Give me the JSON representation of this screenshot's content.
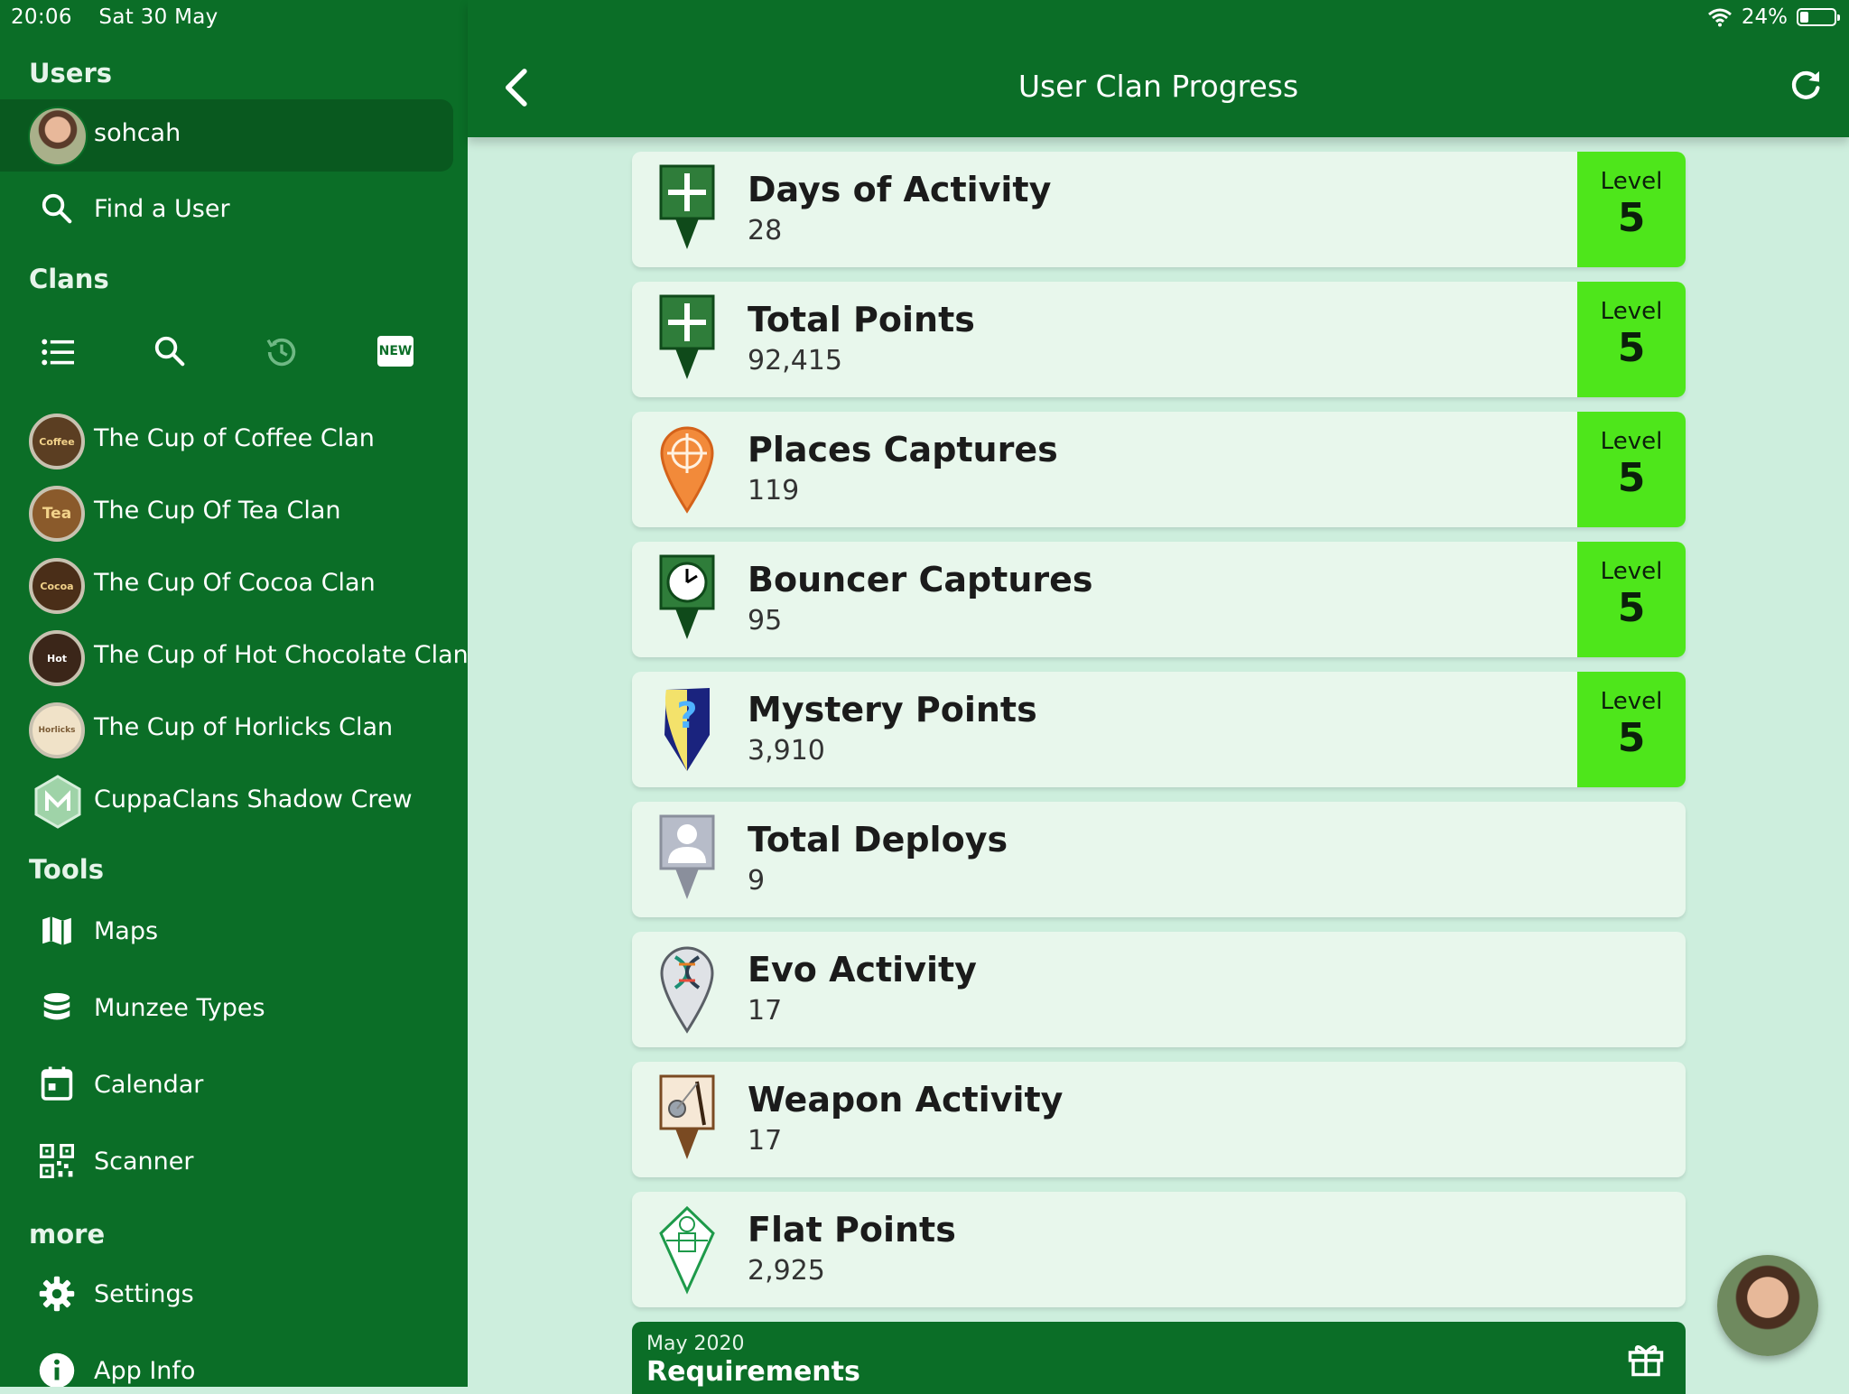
{
  "status_bar": {
    "time": "20:06",
    "date": "Sat 30 May",
    "battery": "24%",
    "battery_level": 0.24
  },
  "sidebar": {
    "users_title": "Users",
    "current_user": "sohcah",
    "find_user": "Find a User",
    "clans_title": "Clans",
    "clan_toolbar": [
      "list-icon",
      "search-icon",
      "history-icon",
      "new-icon"
    ],
    "new_badge": "NEW",
    "clans": [
      {
        "name": "The Cup of Coffee Clan",
        "badge": "Coffee"
      },
      {
        "name": "The Cup Of Tea Clan",
        "badge": "Tea"
      },
      {
        "name": "The Cup Of Cocoa Clan",
        "badge": "Cocoa"
      },
      {
        "name": "The Cup of Hot Chocolate Clan",
        "badge": "Hot"
      },
      {
        "name": "The Cup of Horlicks Clan",
        "badge": "Horlicks"
      },
      {
        "name": "CuppaClans Shadow Crew",
        "badge": ""
      }
    ],
    "tools_title": "Tools",
    "tools": [
      {
        "label": "Maps",
        "icon": "map-icon"
      },
      {
        "label": "Munzee Types",
        "icon": "database-icon"
      },
      {
        "label": "Calendar",
        "icon": "calendar-icon"
      },
      {
        "label": "Scanner",
        "icon": "qr-code-icon"
      }
    ],
    "more_title": "more",
    "more": [
      {
        "label": "Settings",
        "icon": "gear-icon"
      },
      {
        "label": "App Info",
        "icon": "info-icon"
      }
    ]
  },
  "header": {
    "title": "User Clan Progress",
    "back_icon": "chevron-left-icon",
    "refresh_icon": "refresh-icon"
  },
  "requirements": [
    {
      "title": "Days of Activity",
      "value": "28",
      "level_label": "Level",
      "level": "5",
      "icon": "green-plus-pin-icon"
    },
    {
      "title": "Total Points",
      "value": "92,415",
      "level_label": "Level",
      "level": "5",
      "icon": "green-plus-pin-icon"
    },
    {
      "title": "Places Captures",
      "value": "119",
      "level_label": "Level",
      "level": "5",
      "icon": "orange-target-pin-icon"
    },
    {
      "title": "Bouncer Captures",
      "value": "95",
      "level_label": "Level",
      "level": "5",
      "icon": "clock-pin-icon"
    },
    {
      "title": "Mystery Points",
      "value": "3,910",
      "level_label": "Level",
      "level": "5",
      "icon": "mystery-pin-icon"
    },
    {
      "title": "Total Deploys",
      "value": "9",
      "icon": "person-pin-icon"
    },
    {
      "title": "Evo Activity",
      "value": "17",
      "icon": "evo-pin-icon"
    },
    {
      "title": "Weapon Activity",
      "value": "17",
      "icon": "weapon-pin-icon"
    },
    {
      "title": "Flat Points",
      "value": "2,925",
      "icon": "flat-pin-icon"
    }
  ],
  "footer": {
    "subtitle": "May 2020",
    "title": "Requirements",
    "gift_icon": "gift-icon"
  },
  "colors": {
    "primary": "#0b6e27",
    "level_green": "#4ee61b",
    "card_bg": "#e8f7ec",
    "page_bg": "#cdeedd"
  }
}
